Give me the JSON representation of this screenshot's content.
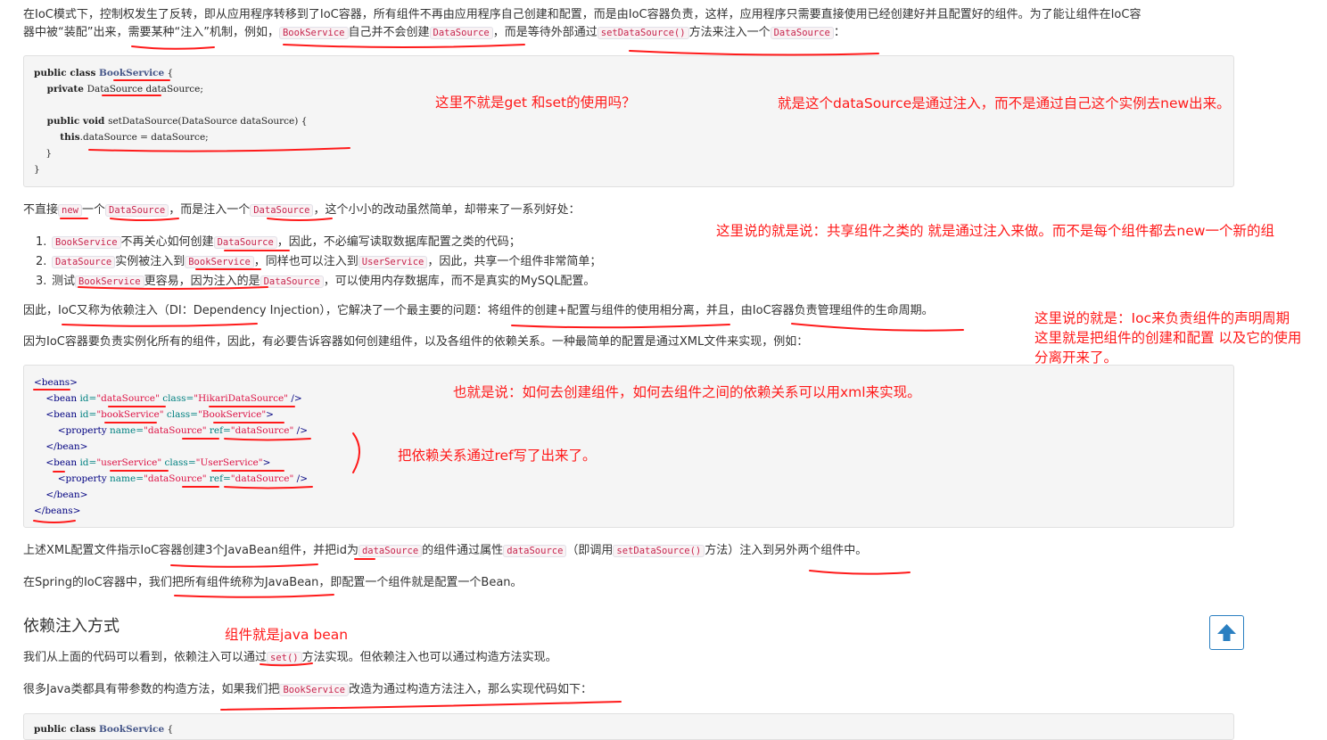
{
  "intro": {
    "l1": "在IoC模式下，控制权发生了反转，即从应用程序转移到了IoC容器，所有组件不再由应用程序自己创建和配置，而是由IoC容器负责，这样，应用程序只需要直接使用已经创建好并且配置好的组件。为了能让组件在IoC容",
    "l2_a": "器中被“装配”出来，需要某种“注入”机制，例如，",
    "c1": "BookService",
    "l2_b": "自己并不会创建",
    "c2": "DataSource",
    "l2_c": "，而是等待外部通过",
    "c3": "setDataSource()",
    "l2_d": "方法来注入一个",
    "c4": "DataSource",
    "l2_e": "："
  },
  "code1": {
    "l1a": "public class ",
    "l1b": "BookService",
    "l1c": " {",
    "l2a": "    private ",
    "l2b": "DataSource",
    "l2c": " dataSource;",
    "l4a": "    public void ",
    "l4b": "setDataSource(DataSource dataSource) {",
    "l5a": "        this",
    "l5b": ".dataSource = dataSource;",
    "l6": "    }",
    "l7": "}"
  },
  "p2": {
    "a": "不直接",
    "c1": "new",
    "b": "一个",
    "c2": "DataSource",
    "c": "，而是注入一个",
    "c3": "DataSource",
    "d": "，这个小小的改动虽然简单，却带来了一系列好处："
  },
  "list": [
    {
      "num": "1.",
      "c1": "BookService",
      "t1": "不再关心如何创建",
      "c2": "DataSource",
      "t2": "，因此，不必编写读取数据库配置之类的代码；"
    },
    {
      "num": "2.",
      "c1": "DataSource",
      "t1": "实例被注入到",
      "c2": "BookService",
      "t2": "，同样也可以注入到",
      "c3": "UserService",
      "t3": "，因此，共享一个组件非常简单；"
    },
    {
      "num": "3.",
      "t0": "测试",
      "c1": "BookService",
      "t1": "更容易，因为注入的是",
      "c2": "DataSource",
      "t2": "，可以使用内存数据库，而不是真实的MySQL配置。"
    }
  ],
  "p3": "因此，IoC又称为依赖注入（DI：Dependency Injection），它解决了一个最主要的问题：将组件的创建+配置与组件的使用相分离，并且，由IoC容器负责管理组件的生命周期。",
  "p4": "因为IoC容器要负责实例化所有的组件，因此，有必要告诉容器如何创建组件，以及各组件的依赖关系。一种最简单的配置是通过XML文件来实现，例如：",
  "xml": {
    "open": "<beans>",
    "b1a": "    <bean ",
    "b1k1": "id=",
    "b1v1": "\"dataSource\"",
    "b1k2": " class=",
    "b1v2": "\"HikariDataSource\"",
    "b1e": " />",
    "b2a": "    <bean ",
    "b2k1": "id=",
    "b2v1": "\"bookService\"",
    "b2k2": " class=",
    "b2v2": "\"BookService\"",
    "b2e": ">",
    "p1a": "        <property ",
    "p1k1": "name=",
    "p1v1": "\"dataSource\"",
    "p1k2": " ref=",
    "p1v2": "\"dataSource\"",
    "p1e": " />",
    "b2close": "    </bean>",
    "b3a": "    <bean ",
    "b3k1": "id=",
    "b3v1": "\"userService\"",
    "b3k2": " class=",
    "b3v2": "\"UserService\"",
    "b3e": ">",
    "p2a": "        <property ",
    "p2k1": "name=",
    "p2v1": "\"dataSource\"",
    "p2k2": " ref=",
    "p2v2": "\"dataSource\"",
    "p2e": " />",
    "b3close": "    </bean>",
    "close": "</beans>"
  },
  "p5": {
    "a": "上述XML配置文件指示IoC容器创建3个JavaBean组件，并把id为",
    "c1": "dataSource",
    "b": "的组件通过属性",
    "c2": "dataSource",
    "c": "（即调用",
    "c3": "setDataSource()",
    "d": "方法）注入到另外两个组件中。"
  },
  "p6": "在Spring的IoC容器中，我们把所有组件统称为JavaBean，即配置一个组件就是配置一个Bean。",
  "h2": "依赖注入方式",
  "p7": {
    "a": "我们从上面的代码可以看到，依赖注入可以通过",
    "c1": "set()",
    "b": "方法实现。但依赖注入也可以通过构造方法实现。"
  },
  "p8": {
    "a": "很多Java类都具有带参数的构造方法，如果我们把",
    "c1": "BookService",
    "b": "改造为通过构造方法注入，那么实现代码如下："
  },
  "code2": {
    "l1a": "public class ",
    "l1b": "BookService",
    "l1c": " {"
  },
  "notes": {
    "n1": "这里不就是get  和set的使用吗？",
    "n2": "就是这个dataSource是通过注入，而不是通过自己这个实例去new出来。",
    "n3": "这里说的就是说：共享组件之类的  就是通过注入来做。而不是每个组件都去new一个新的组",
    "n4a": "这里说的就是：Ioc来负责组件的声明周期",
    "n4b": "这里就是把组件的创建和配置  以及它的使用",
    "n4c": "分离开来了。",
    "n5": "也就是说：如何去创建组件，如何去组件之间的依赖关系可以用xml来实现。",
    "n6": "把依赖关系通过ref写了出来了。",
    "n7": "组件就是java bean"
  },
  "colors": {
    "annotation": "#ff1a1a",
    "inline_code": "#c7254e",
    "code_bg": "#f5f5f5",
    "top_button": "#2a7fc1"
  },
  "icons": {
    "back_to_top": "arrow-up-icon"
  }
}
